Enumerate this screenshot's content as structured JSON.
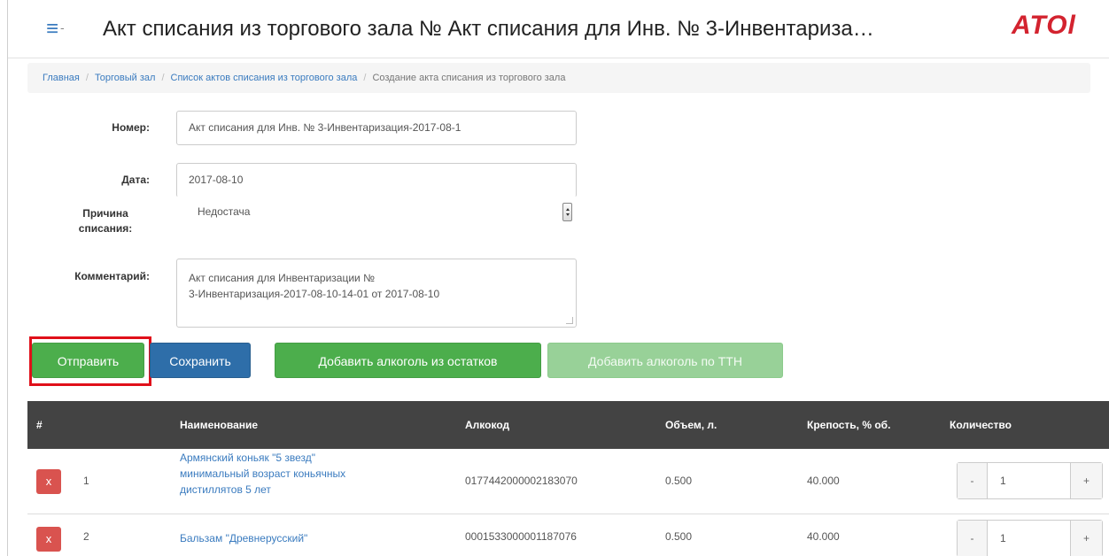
{
  "header": {
    "menu_icon": "hamburger-icon",
    "title": "Акт списания из торгового зала № Акт списания для Инв. № 3-Инвентариза…",
    "logo": "ATOl"
  },
  "breadcrumb": {
    "items": [
      "Главная",
      "Торговый зал",
      "Список актов списания из торгового зала"
    ],
    "active": "Создание акта списания из торгового зала"
  },
  "form": {
    "number": {
      "label": "Номер:",
      "value": "Акт списания для Инв. № 3-Инвентаризация-2017-08-1"
    },
    "date": {
      "label": "Дата:",
      "value": "2017-08-10"
    },
    "reason": {
      "label_line1": "Причина",
      "label_line2": "списания:",
      "value": "Недостача"
    },
    "comment": {
      "label": "Комментарий:",
      "line1": "Акт списания для Инвентаризации №",
      "line2": "3-Инвентаризация-2017-08-10-14-01 от 2017-08-10"
    }
  },
  "actions": {
    "send": "Отправить",
    "save": "Сохранить",
    "add_from_stock": "Добавить алкоголь из остатков",
    "add_by_ttn": "Добавить алкоголь по ТТН",
    "highlight_color": "#e0101a"
  },
  "table": {
    "columns": [
      "#",
      "Наименование",
      "Алкокод",
      "Объем, л.",
      "Крепость, % об.",
      "Количество"
    ],
    "rows": [
      {
        "delete": "x",
        "num": "1",
        "name_line1": "Армянский коньяк \"5 звезд\"",
        "name_line2": "минимальный возраст коньячных",
        "name_line3": "дистиллятов 5 лет",
        "alcocode": "0177442000002183070",
        "volume": "0.500",
        "strength": "40.000",
        "qty_minus": "-",
        "qty": "1",
        "qty_plus": "+"
      },
      {
        "delete": "x",
        "num": "2",
        "name_line1": "Бальзам \"Древнерусский\"",
        "alcocode": "0001533000001187076",
        "volume": "0.500",
        "strength": "40.000",
        "qty_minus": "-",
        "qty": "1",
        "qty_plus": "+"
      }
    ]
  },
  "colors": {
    "primary": "#2e6ea9",
    "success": "#4cae4c",
    "danger": "#d9534f",
    "header_bg": "#434343"
  }
}
